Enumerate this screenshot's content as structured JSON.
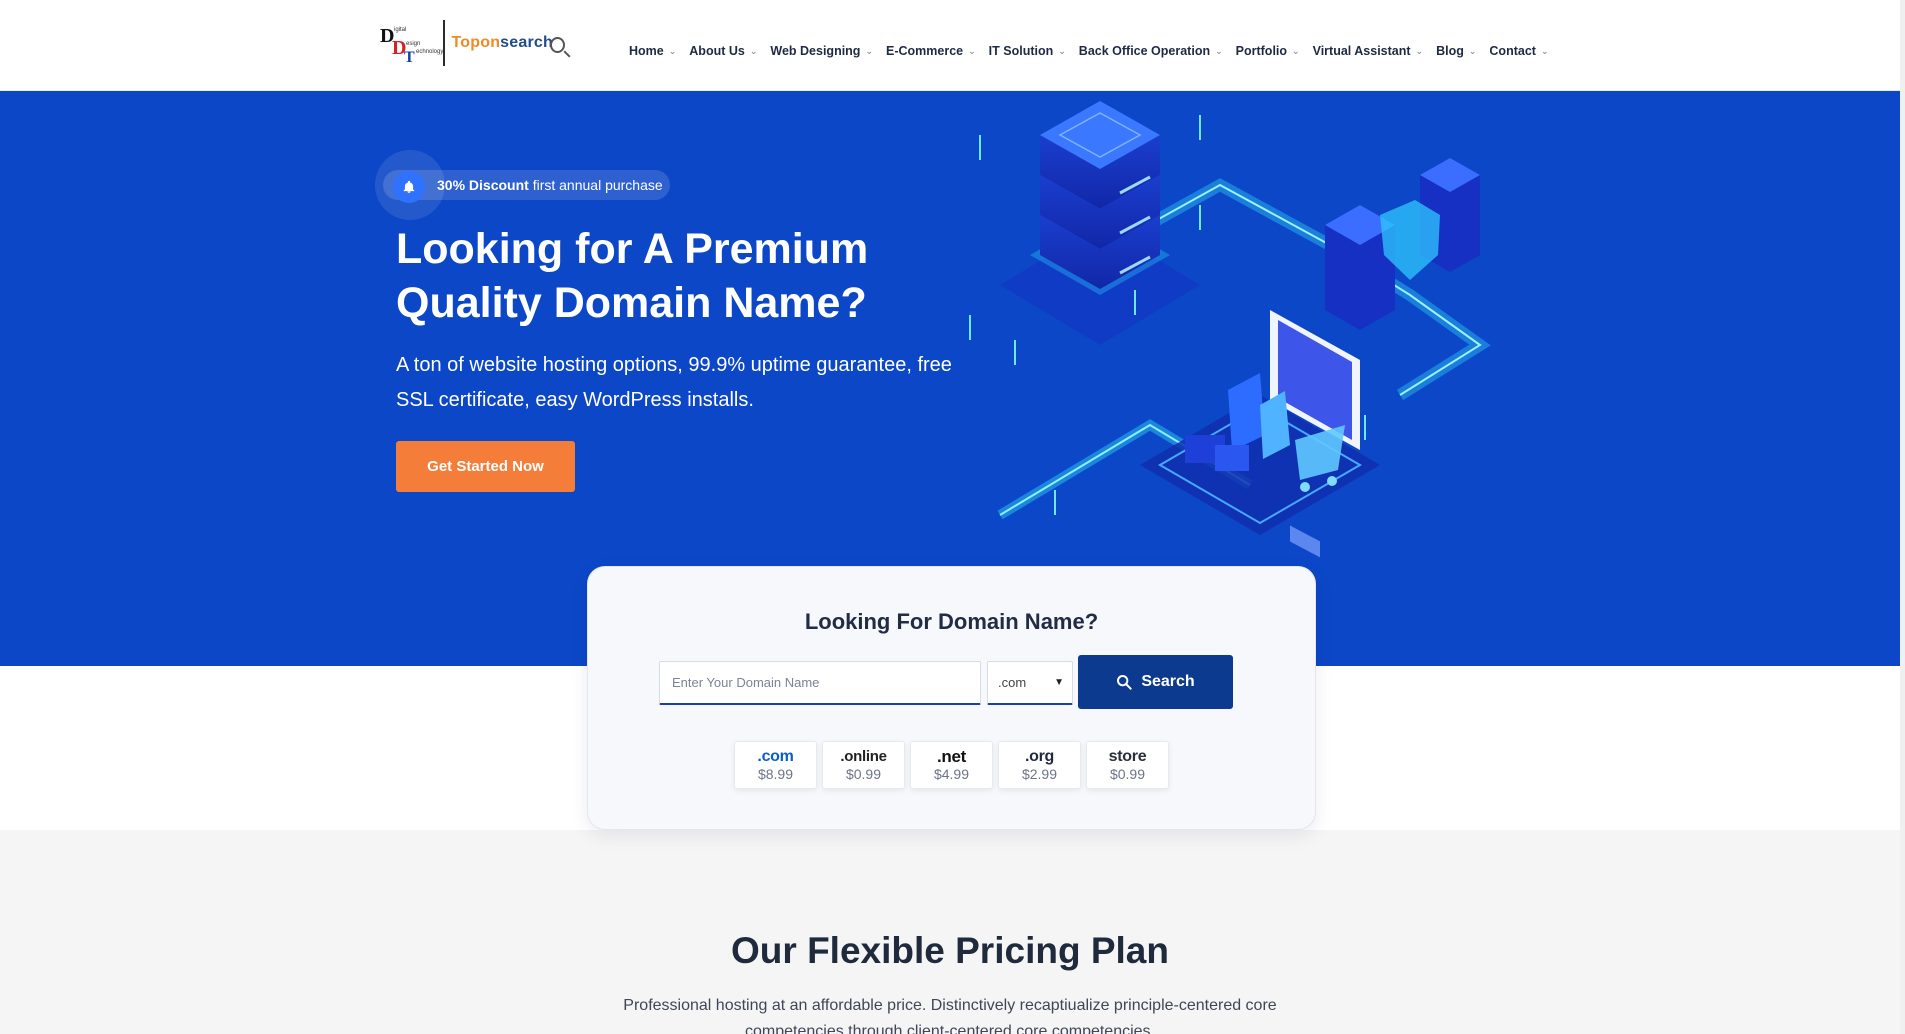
{
  "brand": {
    "logo_letters": [
      "D",
      "D",
      "T"
    ],
    "logo_small_words": [
      "igital",
      "esign",
      "echnology"
    ],
    "name_part1": "Topon",
    "name_part2": "search"
  },
  "nav": {
    "items": [
      {
        "label": "Home"
      },
      {
        "label": "About Us"
      },
      {
        "label": "Web Designing"
      },
      {
        "label": "E-Commerce"
      },
      {
        "label": "IT Solution"
      },
      {
        "label": "Back Office Operation"
      },
      {
        "label": "Portfolio"
      },
      {
        "label": "Virtual Assistant"
      },
      {
        "label": "Blog"
      },
      {
        "label": "Contact"
      }
    ]
  },
  "hero": {
    "badge_bold": "30% Discount",
    "badge_rest": " first annual purchase",
    "title": "Looking for A Premium Quality Domain Name?",
    "subtitle": "A ton of website hosting options, 99.9% uptime guarantee, free SSL certificate, easy WordPress installs.",
    "cta_label": "Get Started Now",
    "icon": "bell-icon"
  },
  "domain_search": {
    "title": "Looking For Domain Name?",
    "input_placeholder": "Enter Your Domain Name",
    "selected_tld": ".com",
    "search_label": "Search",
    "tlds": [
      {
        "name": ".com",
        "price": "$8.99",
        "color": "#0a5fc4"
      },
      {
        "name": ".online",
        "price": "$0.99",
        "color": "#222222"
      },
      {
        "name": ".net",
        "price": "$4.99",
        "color": "#111111"
      },
      {
        "name": ".org",
        "price": "$2.99",
        "color": "#1f2a3d"
      },
      {
        "name": "store",
        "price": "$0.99",
        "color": "#2a2f3a"
      }
    ]
  },
  "pricing": {
    "title": "Our Flexible Pricing Plan",
    "description": "Professional hosting at an affordable price. Distinctively recaptiualize principle-centered core competencies through client-centered core competencies."
  },
  "colors": {
    "hero_bg": "#0c47c7",
    "cta": "#f47d3a",
    "search_btn": "#0b3a8f"
  }
}
